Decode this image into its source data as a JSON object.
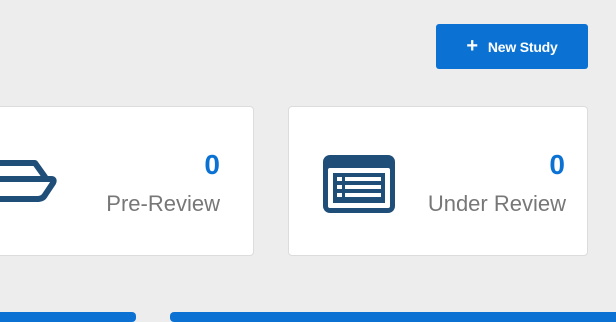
{
  "toolbar": {
    "new_study_label": "New Study",
    "new_study_icon": "plus-icon"
  },
  "cards": [
    {
      "count": "0",
      "label": "Pre-Review",
      "icon": "tray-icon"
    },
    {
      "count": "0",
      "label": "Under Review",
      "icon": "list-window-icon"
    }
  ],
  "colors": {
    "accent": "#0b72d4",
    "icon_dark": "#1f4e79",
    "background": "#ededed",
    "card": "#ffffff",
    "label_text": "#777777"
  }
}
